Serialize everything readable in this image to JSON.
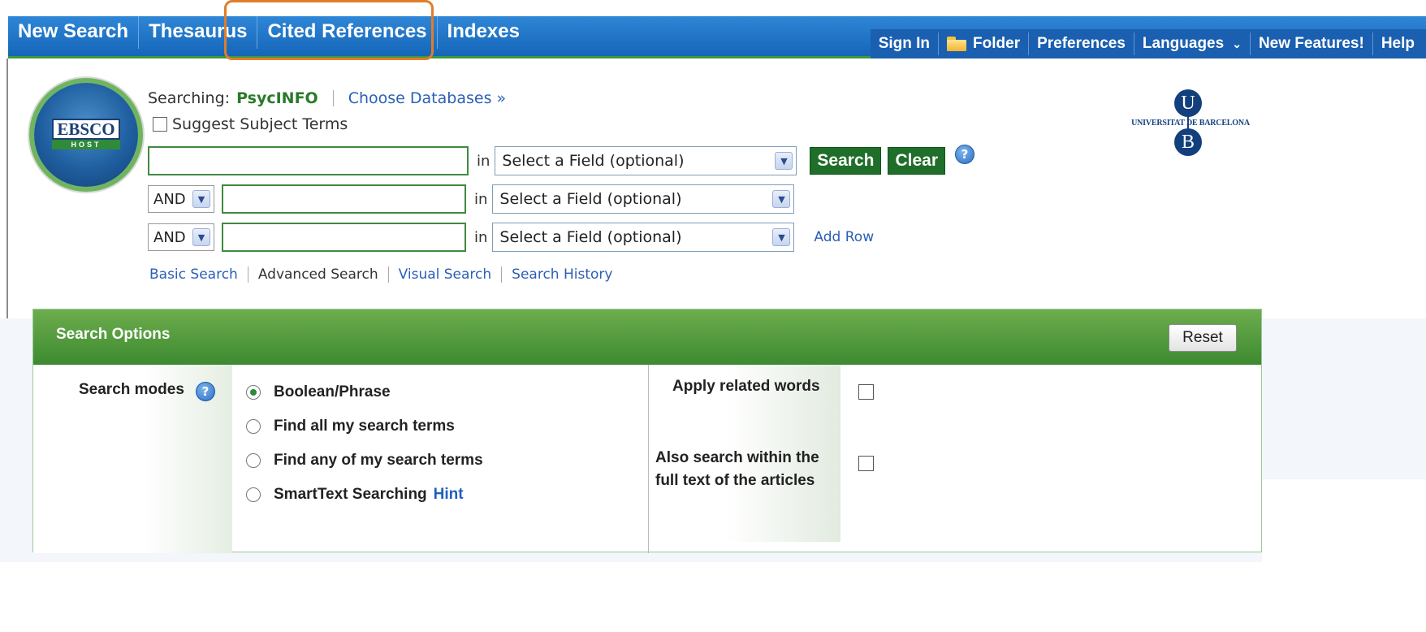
{
  "nav": {
    "items": [
      "New Search",
      "Thesaurus",
      "Cited References",
      "Indexes"
    ],
    "right_items": [
      "Sign In",
      "Folder",
      "Preferences",
      "Languages",
      "New Features!",
      "Help"
    ]
  },
  "logo": {
    "ebsco_line1": "EBSCO",
    "ebsco_line2": "HOST"
  },
  "university": {
    "letter_top": "U",
    "letter_bottom": "B",
    "name": "UNIVERSITAT DE BARCELONA"
  },
  "search": {
    "searching_label": "Searching:",
    "database": "PsycINFO",
    "choose_databases": "Choose Databases »",
    "suggest_subject_terms": "Suggest Subject Terms",
    "in_label": "in",
    "field_placeholder": "Select a Field (optional)",
    "bool_operator": "AND",
    "search_button": "Search",
    "clear_button": "Clear",
    "add_row": "Add Row",
    "modes": [
      "Basic Search",
      "Advanced Search",
      "Visual Search",
      "Search History"
    ]
  },
  "options": {
    "title": "Search Options",
    "reset": "Reset",
    "search_modes_label": "Search modes",
    "modes": [
      {
        "label": "Boolean/Phrase",
        "selected": true
      },
      {
        "label": "Find all my search terms",
        "selected": false
      },
      {
        "label": "Find any of my search terms",
        "selected": false
      },
      {
        "label": "SmartText Searching",
        "selected": false
      }
    ],
    "hint": "Hint",
    "apply_related_words": "Apply related words",
    "also_search_line1": "Also search within the",
    "also_search_line2": "full text of the articles"
  },
  "colors": {
    "nav_blue": "#1566b8",
    "green": "#1f6e29",
    "highlight": "#e07d2a"
  }
}
